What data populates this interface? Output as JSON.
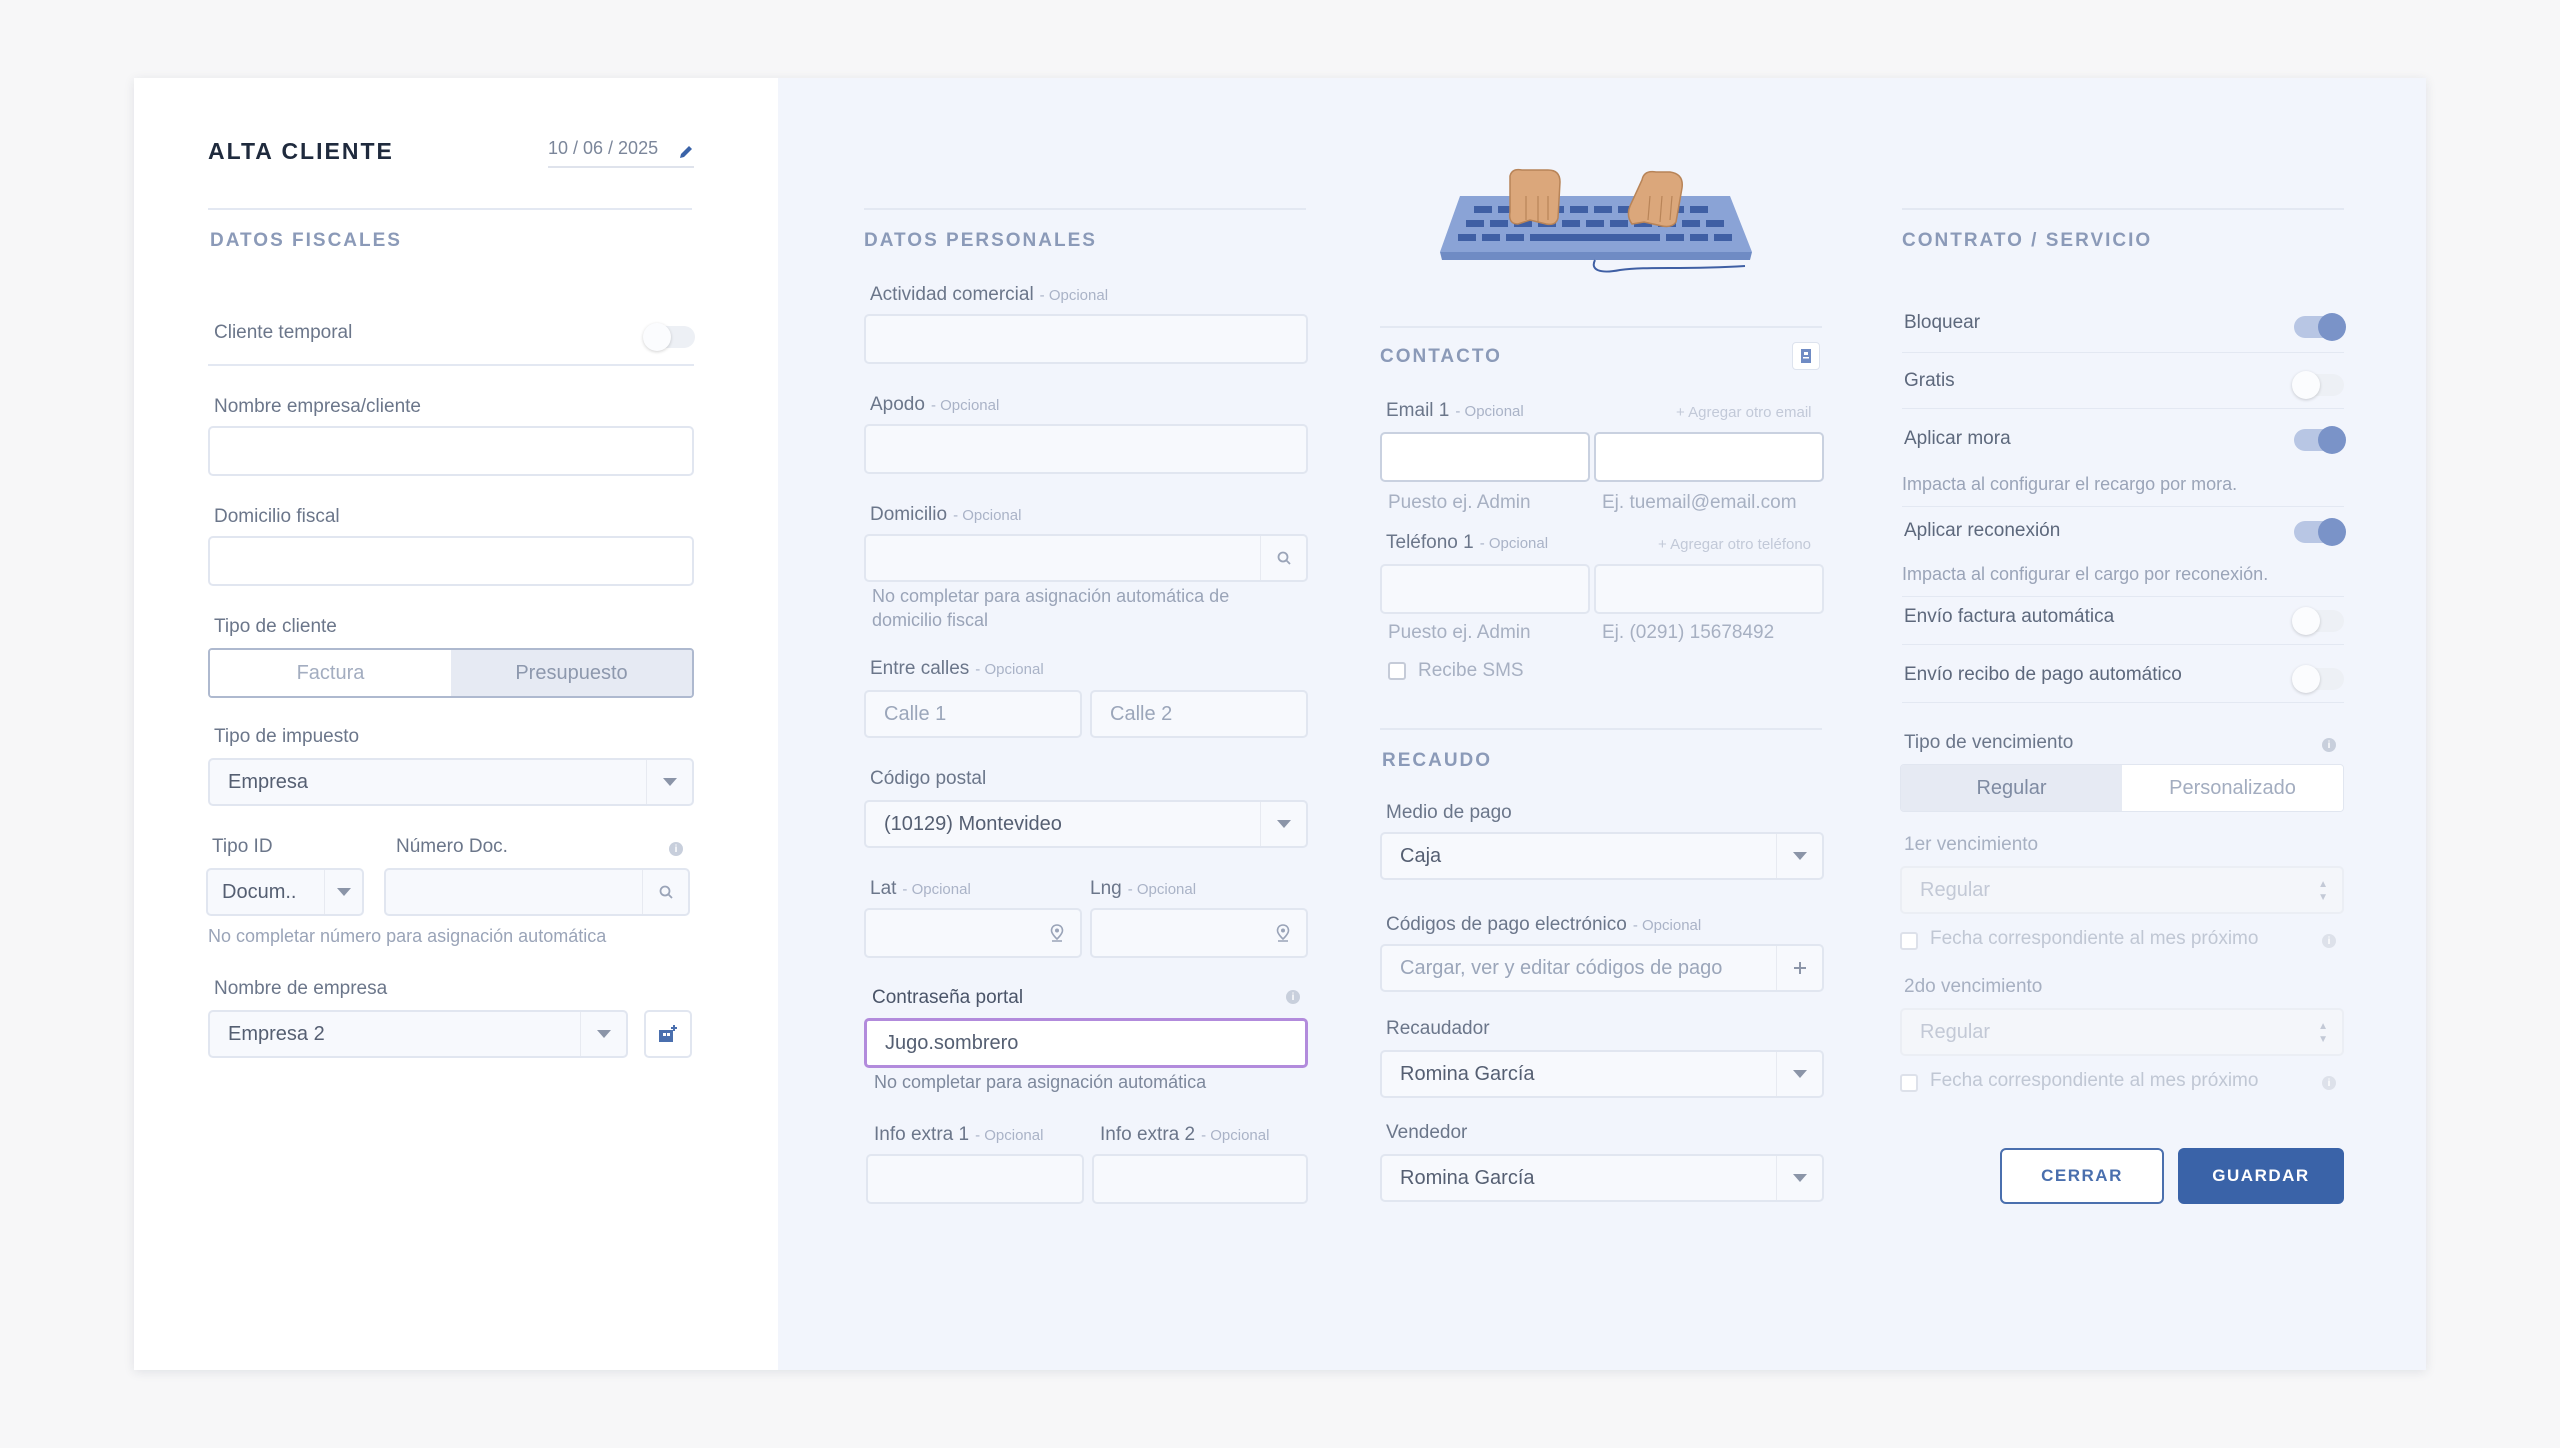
{
  "header": {
    "title": "ALTA CLIENTE",
    "date": "10 / 06 / 2025"
  },
  "fiscal": {
    "section_title": "DATOS FISCALES",
    "temp_client_label": "Cliente temporal",
    "temp_client_on": false,
    "company_name_label": "Nombre empresa/cliente",
    "company_name_value": "",
    "fiscal_address_label": "Domicilio fiscal",
    "fiscal_address_value": "",
    "client_type_label": "Tipo de cliente",
    "client_type_options": [
      "Factura",
      "Presupuesto"
    ],
    "client_type_selected": "Presupuesto",
    "tax_type_label": "Tipo de impuesto",
    "tax_type_value": "Empresa",
    "id_type_label": "Tipo ID",
    "id_type_value": "Docum..",
    "doc_number_label": "Número Doc.",
    "doc_number_value": "",
    "doc_hint": "No completar número para asignación automática",
    "business_name_label": "Nombre de empresa",
    "business_name_value": "Empresa 2"
  },
  "personal": {
    "section_title": "DATOS PERSONALES",
    "optional": "- Opcional",
    "activity_label": "Actividad comercial",
    "alias_label": "Apodo",
    "address_label": "Domicilio",
    "address_hint": "No completar para asignación automática de domicilio fiscal",
    "streets_label": "Entre calles",
    "street1_placeholder": "Calle 1",
    "street2_placeholder": "Calle 2",
    "postal_code_label": "Código postal",
    "postal_code_value": "(10129) Montevideo",
    "lat_label": "Lat",
    "lng_label": "Lng",
    "password_label": "Contraseña portal",
    "password_value": "Jugo.sombrero",
    "password_hint": "No completar para asignación automática",
    "extra1_label": "Info extra 1",
    "extra2_label": "Info extra 2"
  },
  "contact": {
    "section_title": "CONTACTO",
    "email_label": "Email 1",
    "add_email": "+ Agregar otro email",
    "email_position_placeholder": "Puesto ej. Admin",
    "email_placeholder": "Ej. tuemail@email.com",
    "phone_label": "Teléfono 1",
    "add_phone": "+ Agregar otro teléfono",
    "phone_position_placeholder": "Puesto ej. Admin",
    "phone_placeholder": "Ej. (0291) 15678492",
    "sms_label": "Recibe SMS"
  },
  "collection": {
    "section_title": "RECAUDO",
    "payment_method_label": "Medio de pago",
    "payment_method_value": "Caja",
    "e_codes_label": "Códigos de pago electrónico",
    "e_codes_placeholder": "Cargar, ver y editar códigos de pago",
    "collector_label": "Recaudador",
    "collector_value": "Romina García",
    "seller_label": "Vendedor",
    "seller_value": "Romina García"
  },
  "contract": {
    "section_title": "CONTRATO / SERVICIO",
    "block_label": "Bloquear",
    "block_on": true,
    "free_label": "Gratis",
    "free_on": false,
    "late_fee_label": "Aplicar mora",
    "late_fee_on": true,
    "late_fee_hint": "Impacta al configurar el recargo por mora.",
    "reconnect_label": "Aplicar reconexión",
    "reconnect_on": true,
    "reconnect_hint": "Impacta al configurar el cargo por reconexión.",
    "auto_invoice_label": "Envío factura automática",
    "auto_invoice_on": false,
    "auto_receipt_label": "Envío recibo de pago automático",
    "auto_receipt_on": false,
    "due_type_label": "Tipo de vencimiento",
    "due_type_options": [
      "Regular",
      "Personalizado"
    ],
    "due_type_selected": "Regular",
    "first_due_label": "1er vencimiento",
    "first_due_value": "Regular",
    "first_due_next_month": "Fecha correspondiente al mes próximo",
    "second_due_label": "2do vencimiento",
    "second_due_value": "Regular",
    "second_due_next_month": "Fecha correspondiente al mes próximo"
  },
  "actions": {
    "close_label": "CERRAR",
    "save_label": "GUARDAR"
  },
  "colors": {
    "primary": "#3a63a8",
    "focus": "#b28bdc",
    "toggle_on": "#7a93c8"
  }
}
